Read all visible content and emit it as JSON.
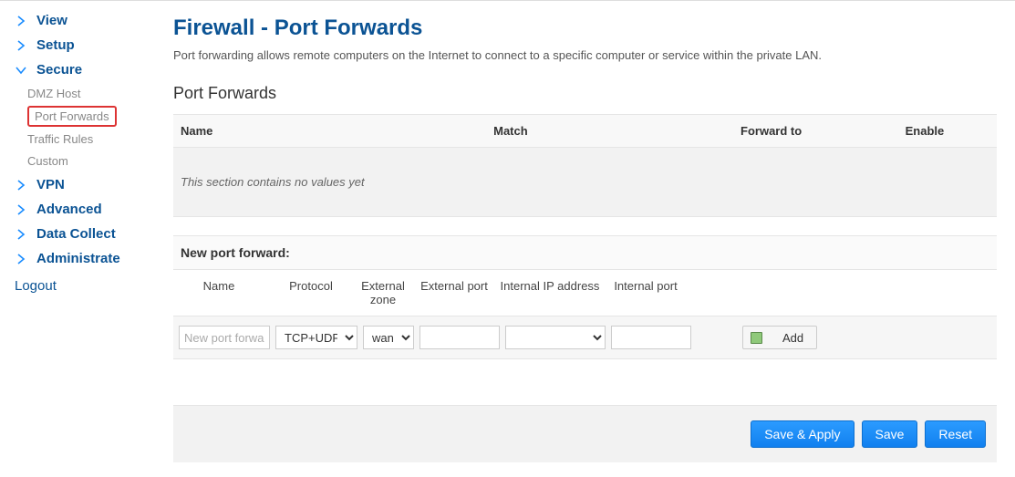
{
  "sidebar": {
    "items": [
      {
        "label": "View",
        "expanded": false
      },
      {
        "label": "Setup",
        "expanded": false
      },
      {
        "label": "Secure",
        "expanded": true,
        "children": [
          {
            "label": "DMZ Host",
            "active": false
          },
          {
            "label": "Port Forwards",
            "active": true
          },
          {
            "label": "Traffic Rules",
            "active": false
          },
          {
            "label": "Custom",
            "active": false
          }
        ]
      },
      {
        "label": "VPN",
        "expanded": false
      },
      {
        "label": "Advanced",
        "expanded": false
      },
      {
        "label": "Data Collect",
        "expanded": false
      },
      {
        "label": "Administrate",
        "expanded": false
      }
    ],
    "logout": "Logout"
  },
  "page": {
    "title": "Firewall - Port Forwards",
    "description": "Port forwarding allows remote computers on the Internet to connect to a specific computer or service within the private LAN."
  },
  "forwards_table": {
    "title": "Port Forwards",
    "columns": {
      "name": "Name",
      "match": "Match",
      "forward_to": "Forward to",
      "enable": "Enable"
    },
    "empty_msg": "This section contains no values yet"
  },
  "new_form": {
    "title": "New port forward:",
    "headers": {
      "name": "Name",
      "protocol": "Protocol",
      "ext_zone": "External zone",
      "ext_port": "External port",
      "int_ip": "Internal IP address",
      "int_port": "Internal port"
    },
    "placeholder_name": "New port forward",
    "protocol_selected": "TCP+UDP",
    "ext_zone_selected": "wan",
    "add_label": "Add"
  },
  "actions": {
    "save_apply": "Save & Apply",
    "save": "Save",
    "reset": "Reset"
  },
  "colors": {
    "accent": "#0b5394",
    "button": "#1a8cff"
  }
}
